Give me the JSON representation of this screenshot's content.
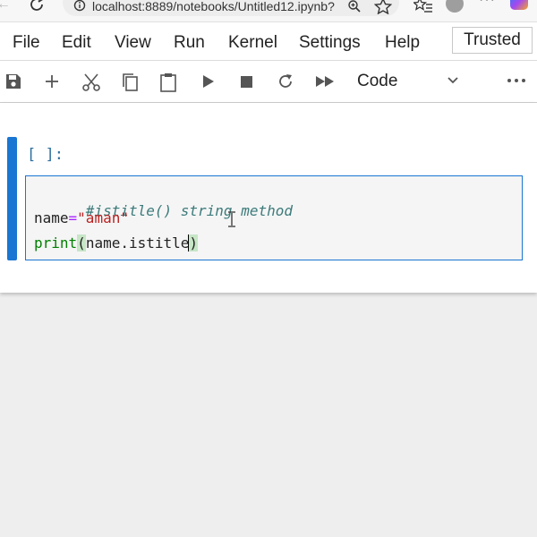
{
  "browser": {
    "url": "localhost:8889/notebooks/Untitled12.ipynb?",
    "more_label": "···"
  },
  "menu": {
    "items": [
      "File",
      "Edit",
      "View",
      "Run",
      "Kernel",
      "Settings",
      "Help"
    ],
    "trusted": "Trusted"
  },
  "toolbar": {
    "icons": [
      "save-icon",
      "add-cell-icon",
      "cut-icon",
      "copy-icon",
      "paste-icon",
      "run-icon",
      "stop-icon",
      "restart-icon",
      "run-all-icon"
    ],
    "cell_type": "Code"
  },
  "cell": {
    "prompt": "[ ]:",
    "line1": "#istitle() string method",
    "line2_var": "name",
    "line2_eq": "=",
    "line2_str": "\"aman\"",
    "line3_fn": "print",
    "line3_open": "(",
    "line3_body": "name.istitle",
    "line3_close": ")"
  },
  "colors": {
    "accent": "#1976d2",
    "comment": "#3c7a7a",
    "string": "#ba2121",
    "builtin": "#008000"
  }
}
